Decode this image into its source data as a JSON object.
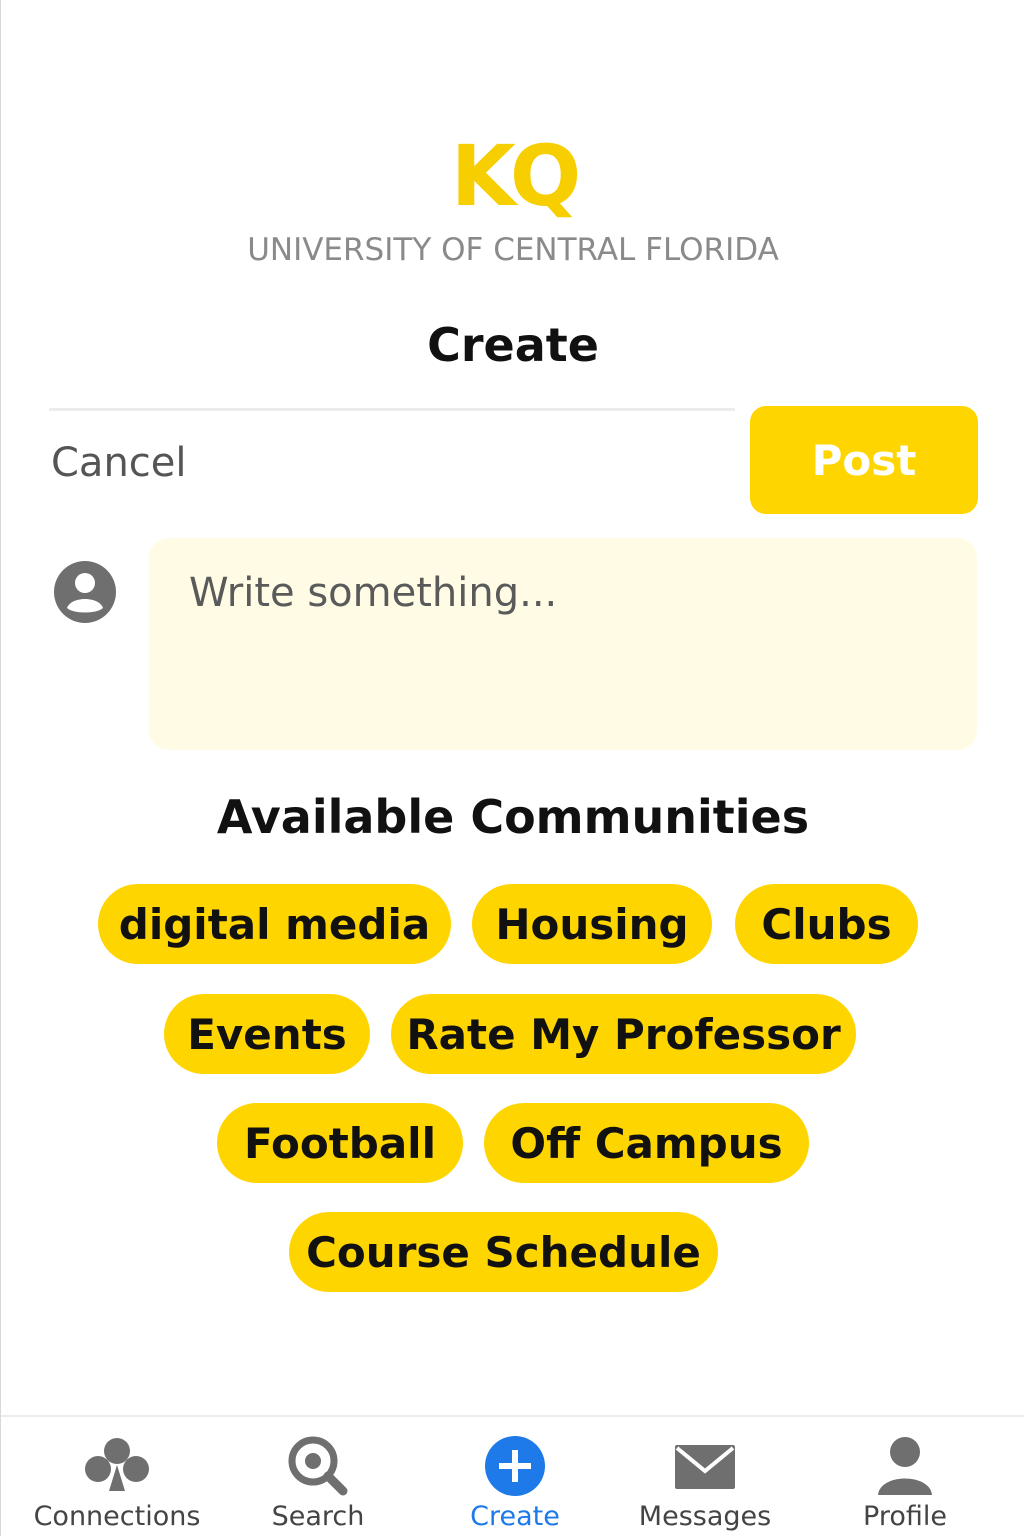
{
  "brand": {
    "logo": "KQ",
    "university": "UNIVERSITY OF CENTRAL FLORIDA"
  },
  "header": {
    "title": "Create"
  },
  "actions": {
    "cancel_label": "Cancel",
    "post_label": "Post"
  },
  "composer": {
    "placeholder": "Write something...",
    "avatar_icon": "user-circle-icon"
  },
  "communities": {
    "title": "Available Communities",
    "items": [
      "digital media",
      "Housing",
      "Clubs",
      "Events",
      "Rate My Professor",
      "Football",
      "Off Campus",
      "Course Schedule"
    ]
  },
  "tabs": [
    {
      "label": "Connections",
      "icon": "connections-icon",
      "active": false
    },
    {
      "label": "Search",
      "icon": "search-icon",
      "active": false
    },
    {
      "label": "Create",
      "icon": "plus-circle-icon",
      "active": true
    },
    {
      "label": "Messages",
      "icon": "envelope-icon",
      "active": false
    },
    {
      "label": "Profile",
      "icon": "person-icon",
      "active": false
    }
  ],
  "colors": {
    "accent": "#ffd500",
    "active_tab": "#1e7ae8",
    "composer_bg": "#fffbe5"
  }
}
